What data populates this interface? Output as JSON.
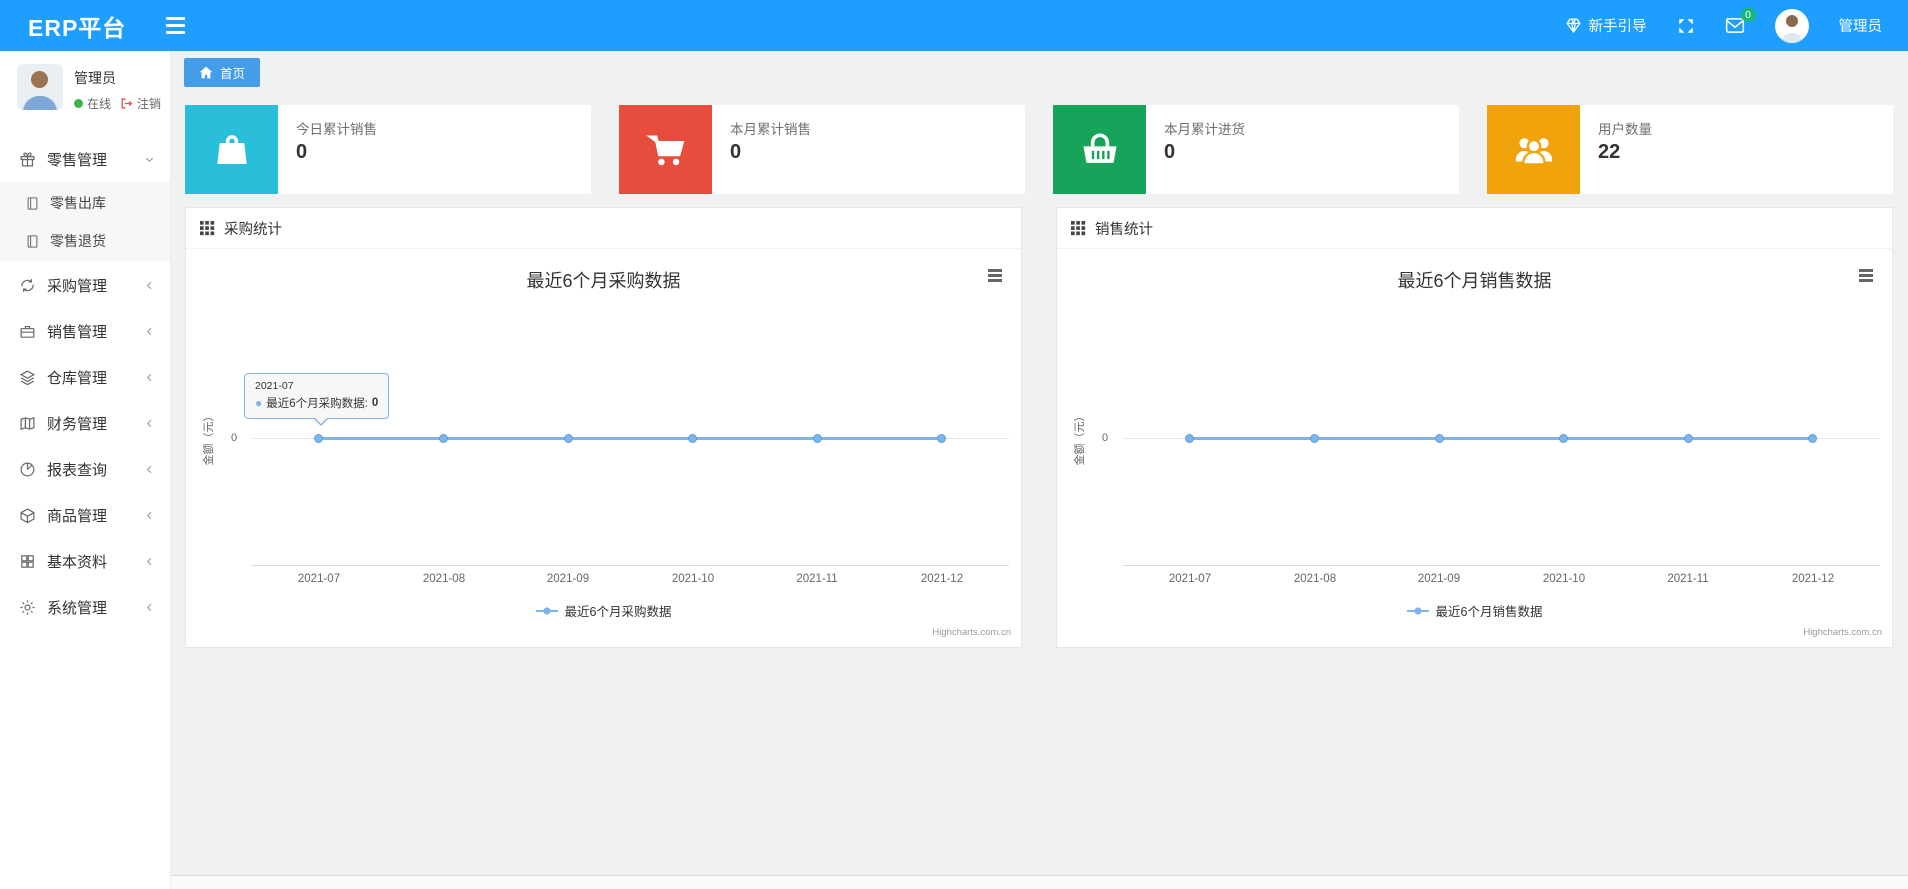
{
  "navbar": {
    "brand": "ERP平台",
    "guide_label": "新手引导",
    "mail_badge": "0",
    "username": "管理员"
  },
  "sidebar": {
    "user": {
      "name": "管理员",
      "status": "在线",
      "logout": "注销"
    },
    "groups": [
      {
        "label": "零售管理",
        "icon": "gift-icon",
        "expanded": true,
        "children": [
          {
            "label": "零售出库"
          },
          {
            "label": "零售退货"
          }
        ]
      },
      {
        "label": "采购管理",
        "icon": "sync-icon"
      },
      {
        "label": "销售管理",
        "icon": "briefcase-icon"
      },
      {
        "label": "仓库管理",
        "icon": "layers-icon"
      },
      {
        "label": "财务管理",
        "icon": "map-icon"
      },
      {
        "label": "报表查询",
        "icon": "pie-chart-icon"
      },
      {
        "label": "商品管理",
        "icon": "box-icon"
      },
      {
        "label": "基本资料",
        "icon": "grid-icon"
      },
      {
        "label": "系统管理",
        "icon": "gear-icon"
      }
    ]
  },
  "breadcrumb": {
    "home": "首页"
  },
  "colors": {
    "navbar": "#1E9FFF",
    "tab": "#459de8",
    "card_cyan": "#29bfda",
    "card_red": "#e74c3c",
    "card_green": "#17a45a",
    "card_orange": "#f0a30a",
    "series_line": "#7cb5ec",
    "badge_green": "#16b777"
  },
  "cards": [
    {
      "label": "今日累计销售",
      "value": "0",
      "icon": "shopping-bag-icon",
      "color": "#29bfda"
    },
    {
      "label": "本月累计销售",
      "value": "0",
      "icon": "shopping-cart-icon",
      "color": "#e74c3c"
    },
    {
      "label": "本月累计进货",
      "value": "0",
      "icon": "shopping-basket-icon",
      "color": "#17a45a"
    },
    {
      "label": "用户数量",
      "value": "22",
      "icon": "users-icon",
      "color": "#f0a30a"
    }
  ],
  "panels": [
    {
      "header": "采购统计"
    },
    {
      "header": "销售统计"
    }
  ],
  "chart_data": [
    {
      "type": "line",
      "title": "最近6个月采购数据",
      "categories": [
        "2021-07",
        "2021-08",
        "2021-09",
        "2021-10",
        "2021-11",
        "2021-12"
      ],
      "series": [
        {
          "name": "最近6个月采购数据",
          "values": [
            0,
            0,
            0,
            0,
            0,
            0
          ]
        }
      ],
      "ylabel": "金额（元）",
      "ytick": "0",
      "ylim": [
        0,
        0
      ],
      "legend": "最近6个月采购数据",
      "legend_position": "bottom",
      "grid": "horizontal",
      "credit": "Highcharts.com.cn",
      "tooltip": {
        "header": "2021-07",
        "label": "最近6个月采购数据:",
        "value": "0"
      }
    },
    {
      "type": "line",
      "title": "最近6个月销售数据",
      "categories": [
        "2021-07",
        "2021-08",
        "2021-09",
        "2021-10",
        "2021-11",
        "2021-12"
      ],
      "series": [
        {
          "name": "最近6个月销售数据",
          "values": [
            0,
            0,
            0,
            0,
            0,
            0
          ]
        }
      ],
      "ylabel": "金额（元）",
      "ytick": "0",
      "ylim": [
        0,
        0
      ],
      "legend": "最近6个月销售数据",
      "legend_position": "bottom",
      "grid": "horizontal",
      "credit": "Highcharts.com.cn"
    }
  ]
}
